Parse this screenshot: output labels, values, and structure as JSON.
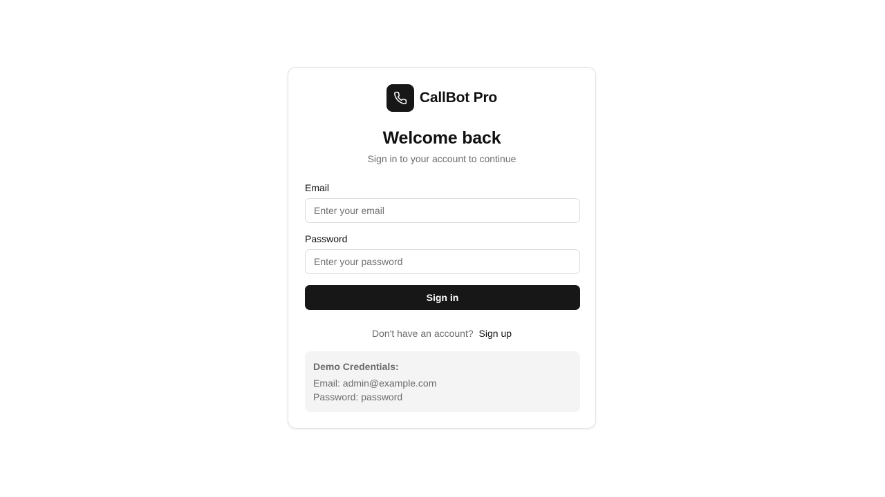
{
  "brand": {
    "logo_icon": "phone-icon",
    "name": "CallBot Pro"
  },
  "header": {
    "title": "Welcome back",
    "subtitle": "Sign in to your account to continue"
  },
  "form": {
    "email_label": "Email",
    "email_placeholder": "Enter your email",
    "email_value": "",
    "password_label": "Password",
    "password_placeholder": "Enter your password",
    "password_value": "",
    "submit_label": "Sign in"
  },
  "signup": {
    "prompt": "Don't have an account?",
    "link_label": "Sign up"
  },
  "demo": {
    "title": "Demo Credentials:",
    "email_line": "Email: admin@example.com",
    "password_line": "Password: password"
  },
  "colors": {
    "primary": "#171717",
    "muted_text": "#6b6b6b",
    "panel_bg": "#f4f4f4",
    "border": "#e2e2e2"
  }
}
